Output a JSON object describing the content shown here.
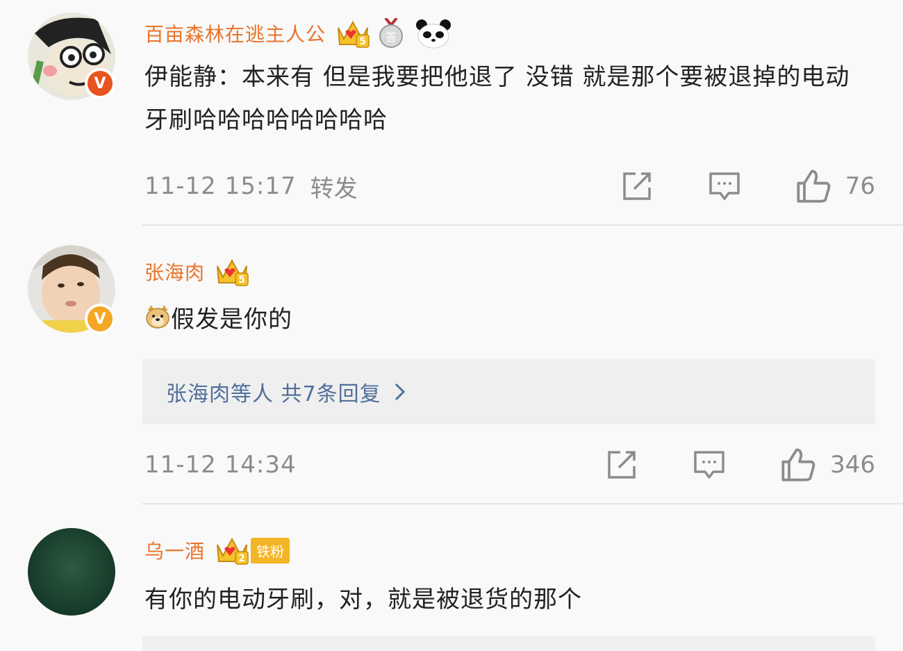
{
  "comments": [
    {
      "username": "百亩森林在逃主人公",
      "crown_level": "5",
      "medal_label": "答",
      "text": "伊能静：本来有 但是我要把他退了 没错 就是那个要被退掉的电动牙刷哈哈哈哈哈哈哈哈",
      "timestamp": "11-12 15:17",
      "repost": "转发",
      "likes": "76",
      "badge": "V"
    },
    {
      "username": "张海肉",
      "crown_level": "5",
      "text": "假发是你的",
      "emoji": "doge-emoji",
      "replies": "张海肉等人 共7条回复",
      "timestamp": "11-12 14:34",
      "likes": "346",
      "badge": "V"
    },
    {
      "username": "乌一酒",
      "crown_level": "2",
      "fan_tag": "铁粉",
      "text": "有你的电动牙刷，对，就是被退货的那个"
    }
  ],
  "icons": {
    "share": "share-icon",
    "comment": "comment-icon",
    "like": "thumbs-up-icon"
  },
  "colors": {
    "username": "#e8742a",
    "reply_link": "#50709a",
    "meta": "#8c8c8c",
    "badge_orange": "#f5a623",
    "fan_tag": "#f3b425"
  }
}
